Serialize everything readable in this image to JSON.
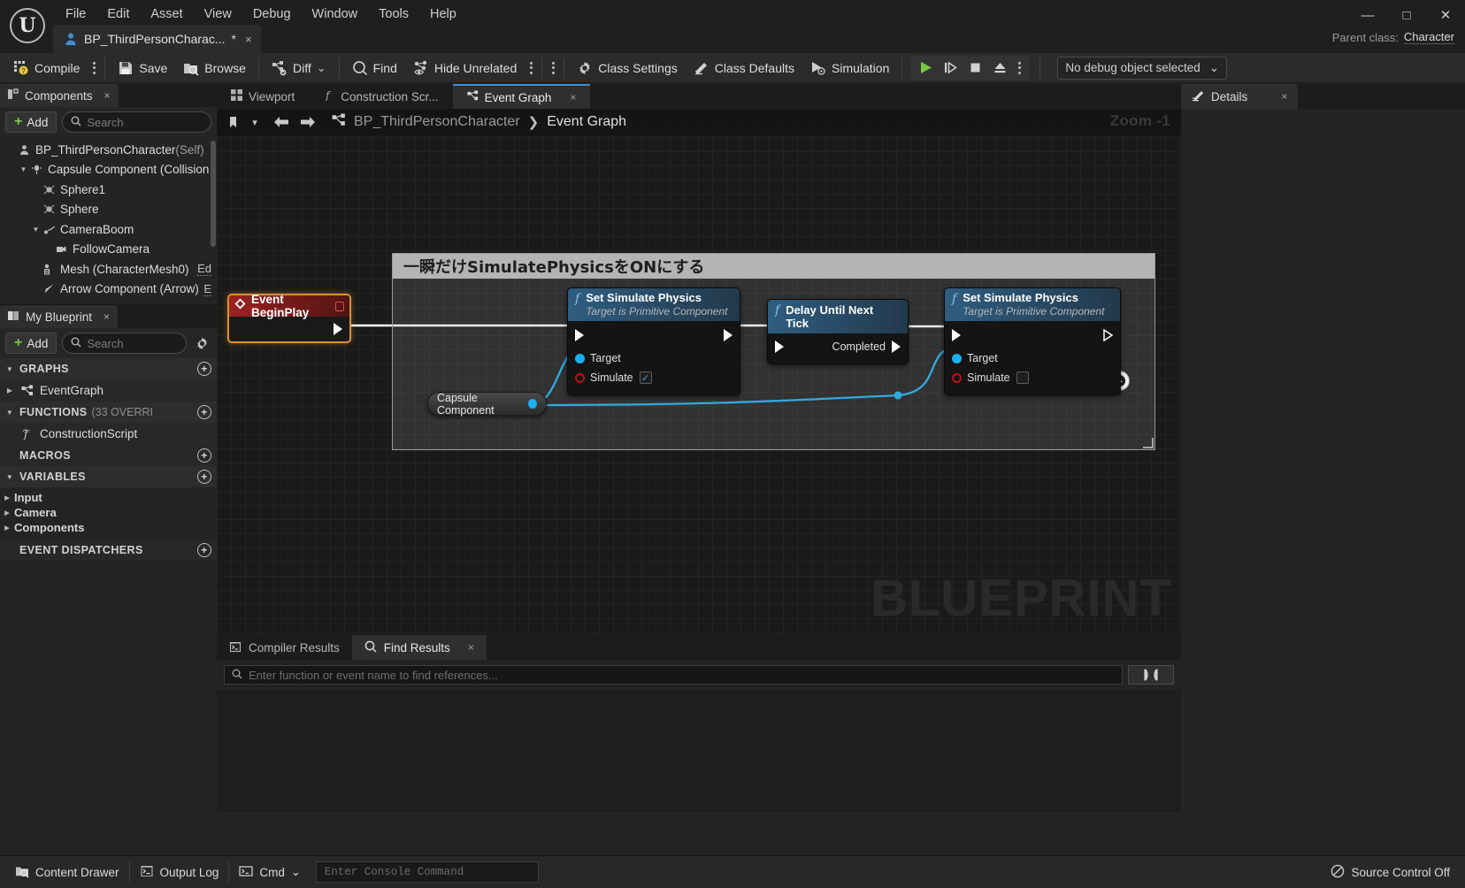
{
  "titlebar": {
    "menus": [
      "File",
      "Edit",
      "Asset",
      "View",
      "Debug",
      "Window",
      "Tools",
      "Help"
    ],
    "asset_tab_label": "BP_ThirdPersonCharac...",
    "asset_tab_dirty": "*",
    "asset_tab_close": "×",
    "minimize": "—",
    "maximize": "□",
    "close": "✕",
    "parent_class_label": "Parent class:",
    "parent_class_value": "Character"
  },
  "toolbar": {
    "compile": "Compile",
    "save": "Save",
    "browse": "Browse",
    "diff": "Diff",
    "diff_caret": "⌄",
    "find": "Find",
    "hide_unrelated": "Hide Unrelated",
    "class_settings": "Class Settings",
    "class_defaults": "Class Defaults",
    "simulation": "Simulation",
    "debug_object": "No debug object selected",
    "debug_caret": "⌄",
    "play_color": "#7ac943"
  },
  "components_panel": {
    "tab_label": "Components",
    "tab_close": "×",
    "add_label": "Add",
    "search_placeholder": "Search",
    "tree": [
      {
        "indent": 0,
        "arrow": "",
        "icon": "character-icon",
        "label": "BP_ThirdPersonCharacter",
        "suffix": " (Self)",
        "edit": ""
      },
      {
        "indent": 1,
        "arrow": "▼",
        "icon": "capsule-icon",
        "label": "Capsule Component (Collision",
        "suffix": "",
        "edit": ""
      },
      {
        "indent": 2,
        "arrow": "",
        "icon": "sphere-icon",
        "label": "Sphere1",
        "suffix": "",
        "edit": ""
      },
      {
        "indent": 2,
        "arrow": "",
        "icon": "sphere-icon",
        "label": "Sphere",
        "suffix": "",
        "edit": ""
      },
      {
        "indent": 2,
        "arrow": "▼",
        "icon": "springarm-icon",
        "label": "CameraBoom",
        "suffix": "",
        "edit": ""
      },
      {
        "indent": 3,
        "arrow": "",
        "icon": "camera-icon",
        "label": "FollowCamera",
        "suffix": "",
        "edit": ""
      },
      {
        "indent": 2,
        "arrow": "",
        "icon": "skeletalmesh-icon",
        "label": "Mesh (CharacterMesh0)",
        "suffix": "",
        "edit": "Ed"
      },
      {
        "indent": 2,
        "arrow": "",
        "icon": "arrow-icon",
        "label": "Arrow Component (Arrow)",
        "suffix": "",
        "edit": "E"
      }
    ]
  },
  "myblueprint_panel": {
    "tab_label": "My Blueprint",
    "tab_close": "×",
    "add_label": "Add",
    "search_placeholder": "Search",
    "sections": [
      {
        "arrow": "▼",
        "title": "GRAPHS",
        "count": "",
        "plus": "+"
      },
      {
        "arrow": "▼",
        "title": "FUNCTIONS",
        "count": "(33 OVERRI",
        "plus": "+"
      },
      {
        "arrow": "",
        "title": "MACROS",
        "count": "",
        "plus": "+"
      },
      {
        "arrow": "▼",
        "title": "VARIABLES",
        "count": "",
        "plus": "+"
      },
      {
        "arrow": "",
        "title": "EVENT DISPATCHERS",
        "count": "",
        "plus": "+"
      }
    ],
    "graphs_item": {
      "arrow": "▶",
      "label": "EventGraph"
    },
    "functions_item": {
      "arrow": "",
      "label": "ConstructionScript"
    },
    "variables": [
      {
        "arrow": "▶",
        "label": "Input"
      },
      {
        "arrow": "▶",
        "label": "Camera"
      },
      {
        "arrow": "▶",
        "label": "Components"
      }
    ]
  },
  "graph": {
    "tabs": [
      {
        "label": "Viewport",
        "icon": "viewport-icon",
        "active": false,
        "close": ""
      },
      {
        "label": "Construction Scr...",
        "icon": "function-icon",
        "active": false,
        "close": ""
      },
      {
        "label": "Event Graph",
        "icon": "graph-icon",
        "active": true,
        "close": "×"
      }
    ],
    "breadcrumb_root": "BP_ThirdPersonCharacter",
    "breadcrumb_sep": "❯",
    "breadcrumb_leaf": "Event Graph",
    "zoom_label": "Zoom -1",
    "watermark": "BLUEPRINT",
    "comment_title": "一瞬だけSimulatePhysicsをONにする",
    "nodes": {
      "event_begin_play": {
        "title": "Event BeginPlay"
      },
      "set_sim_physics_1": {
        "title": "Set Simulate Physics",
        "subtitle": "Target is Primitive Component",
        "target_label": "Target",
        "simulate_label": "Simulate",
        "simulate_checked": true,
        "check_glyph": "✓"
      },
      "delay_until_next_tick": {
        "title": "Delay Until Next Tick",
        "completed_label": "Completed"
      },
      "set_sim_physics_2": {
        "title": "Set Simulate Physics",
        "subtitle": "Target is Primitive Component",
        "target_label": "Target",
        "simulate_label": "Simulate",
        "simulate_checked": false,
        "check_glyph": ""
      },
      "capsule_component_var": {
        "label": "Capsule Component"
      }
    }
  },
  "results_panel": {
    "tabs": [
      {
        "label": "Compiler Results",
        "icon": "compiler-icon",
        "active": false,
        "close": ""
      },
      {
        "label": "Find Results",
        "icon": "search-icon",
        "active": true,
        "close": "×"
      }
    ],
    "search_placeholder": "Enter function or event name to find references..."
  },
  "details_panel": {
    "tab_label": "Details",
    "tab_close": "×"
  },
  "statusbar": {
    "content_drawer": "Content Drawer",
    "output_log": "Output Log",
    "cmd": "Cmd",
    "cmd_caret": "⌄",
    "console_placeholder": "Enter Console Command",
    "source_control": "Source Control Off"
  }
}
